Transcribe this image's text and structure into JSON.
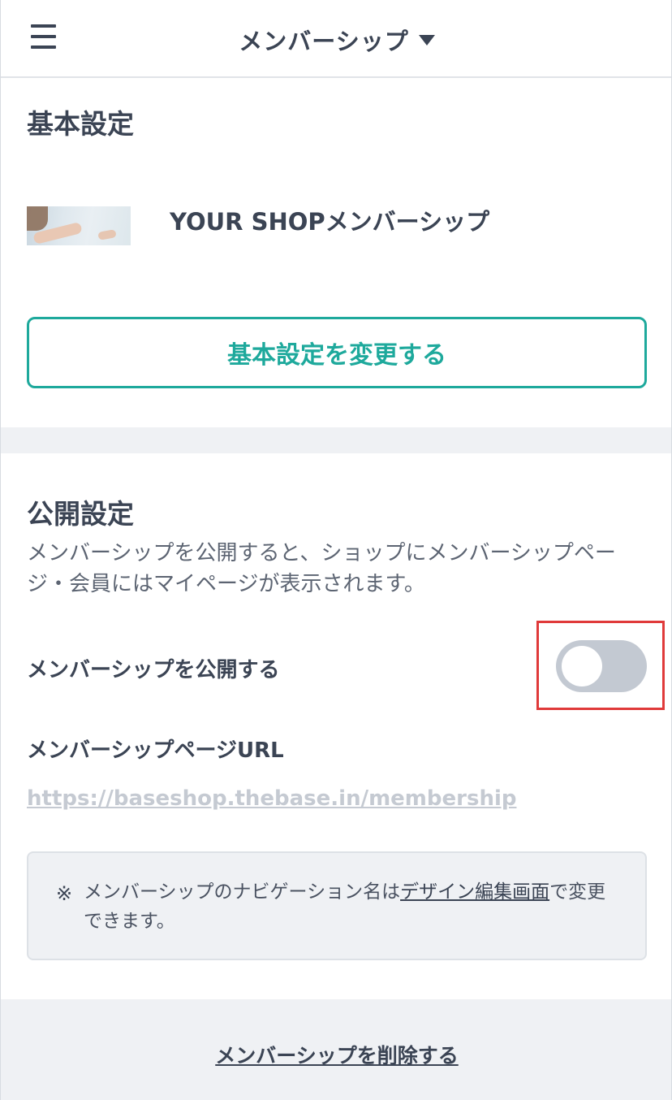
{
  "header": {
    "title": "メンバーシップ"
  },
  "basic": {
    "title": "基本設定",
    "shop_name": "YOUR SHOPメンバーシップ",
    "edit_button": "基本設定を変更する"
  },
  "publish": {
    "title": "公開設定",
    "description": "メンバーシップを公開すると、ショップにメンバーシップページ・会員にはマイページが表示されます。",
    "toggle_label": "メンバーシップを公開する",
    "toggle_on": false,
    "url_label": "メンバーシップページURL",
    "url": "https://baseshop.thebase.in/membership",
    "note_mark": "※",
    "note_prefix": "メンバーシップのナビゲーション名は",
    "note_link": "デザイン編集画面",
    "note_suffix": "で変更できます。"
  },
  "footer": {
    "delete_link": "メンバーシップを削除する"
  },
  "colors": {
    "accent": "#1ea99c",
    "text": "#3b4454",
    "highlight": "#e03a3a",
    "toggle_off": "#c3c9d2"
  }
}
